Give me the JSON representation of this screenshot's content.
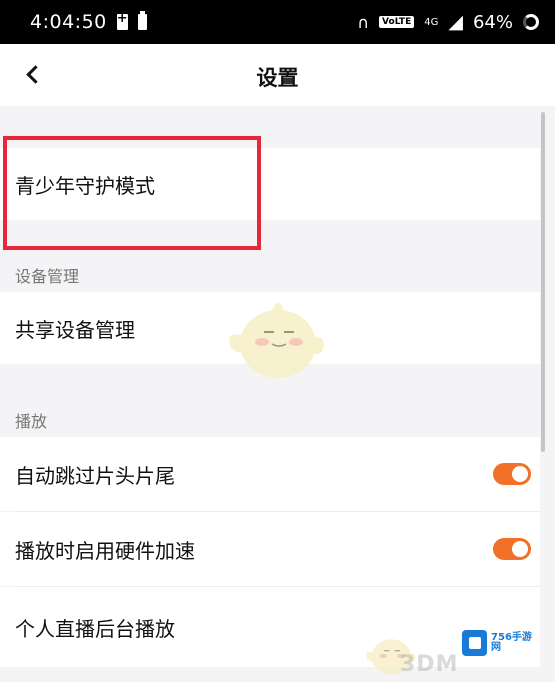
{
  "status_bar": {
    "time": "4:04:50",
    "volte": "VoLTE",
    "network": "4G",
    "battery": "64%"
  },
  "nav": {
    "title": "设置"
  },
  "rows": {
    "teen_mode": "青少年守护模式",
    "shared_device": "共享设备管理",
    "auto_skip": "自动跳过片头片尾",
    "hw_accel": "播放时启用硬件加速",
    "live_bg": "个人直播后台播放"
  },
  "sections": {
    "device": "设备管理",
    "playback": "播放"
  },
  "toggles": {
    "auto_skip": true,
    "hw_accel": true
  },
  "watermark": {
    "badge": "756手游网",
    "text": "3DM"
  },
  "colors": {
    "accent": "#f07127",
    "highlight": "#e8263a"
  }
}
